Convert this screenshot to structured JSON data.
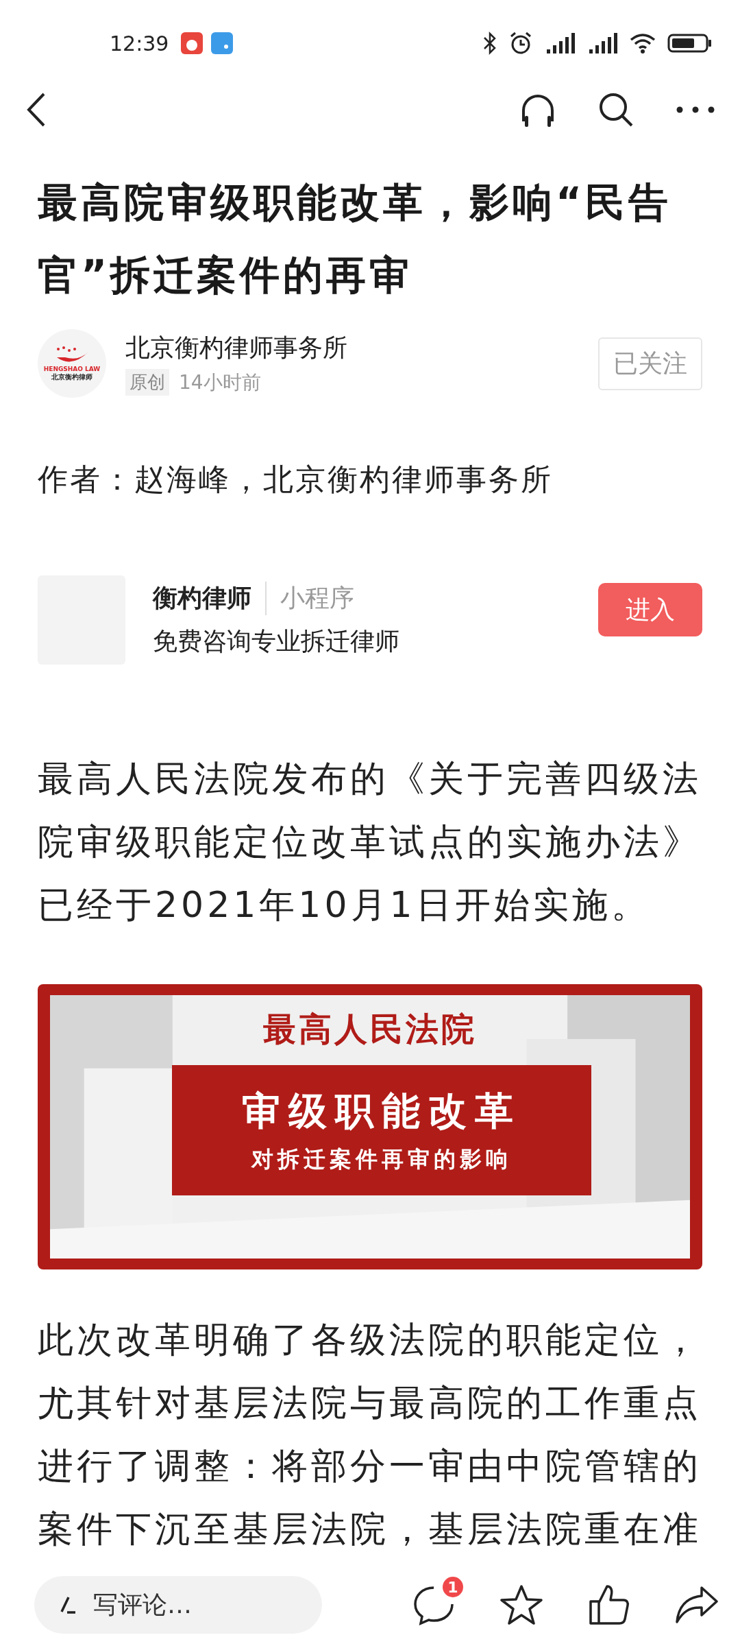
{
  "status_bar": {
    "time": "12:39"
  },
  "title": "最高院审级职能改革，影响“民告官”拆迁案件的再审",
  "author": {
    "name": "北京衡杓律师事务所",
    "tag": "原创",
    "time": "14小时前",
    "follow": "已关注",
    "logo_text": "HENGSHAO LAW",
    "logo_sub": "北京衡杓律师"
  },
  "byline": "作者：赵海峰，北京衡杓律师事务所",
  "mini_program": {
    "name": "衡杓律师",
    "type": "小程序",
    "desc": "免费咨询专业拆迁律师",
    "button": "进入"
  },
  "paragraph_1": "最高人民法院发布的《关于完善四级法院审级职能定位改革试点的实施办法》已经于2021年10月1日开始实施。",
  "banner": {
    "kind": "picture",
    "heading": "最高人民法院",
    "title": "审级职能改革",
    "subtitle": "对拆迁案件再审的影响"
  },
  "paragraph_2": "此次改革明确了各级法院的职能定位，尤其针对基层法院与最高院的工作重点进行了调整：将部分一审由中院管辖的案件下沉至基层法院，基层法院重在准",
  "bottom_bar": {
    "comment_placeholder": "写评论…",
    "comment_count": "1"
  }
}
